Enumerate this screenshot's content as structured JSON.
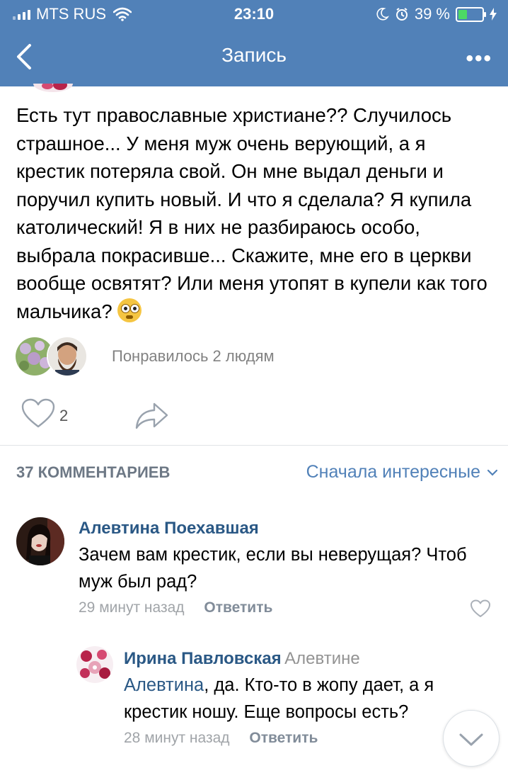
{
  "status_bar": {
    "carrier": "MTS RUS",
    "time": "23:10",
    "battery_percent": "39 %",
    "battery_level": 0.39
  },
  "nav": {
    "title": "Запись",
    "back_icon": "chevron-left-icon",
    "more_label": "•••"
  },
  "post": {
    "text": "Есть тут православные христиане?? Случилось страшное... У меня муж очень верующий, а я крестик потеряла свой. Он мне выдал деньги и поручил купить новый. И что я сделала? Я купила католический! Я в них не разбираюсь особо, выбрала покрасивше... Скажите, мне его в церкви вообще освятят? Или меня утопят в купели как того мальчика?",
    "emoji": "flushed-face-emoji",
    "likers_text": "Понравилось 2 людям",
    "like_count": "2"
  },
  "comments_header": {
    "count_label": "37 КОММЕНТАРИЕВ",
    "sort_label": "Сначала интересные"
  },
  "comments": [
    {
      "author": "Алевтина Поехавшая",
      "reply_to": "",
      "text_link": "",
      "text": "Зачем вам крестик, если вы неверущая? Чтоб муж был рад?",
      "time": "29 минут назад",
      "reply_label": "Ответить"
    },
    {
      "author": "Ирина Павловская",
      "reply_to": "Алевтине",
      "text_link": "Алевтина",
      "text": ", да. Кто-то в жопу дает, а я крестик ношу. Еще вопросы есть?",
      "time": "28 минут назад",
      "reply_label": "Ответить"
    }
  ],
  "colors": {
    "header_bg": "#5181b8",
    "link": "#2a5885",
    "accent": "#5181b8",
    "muted": "#828282"
  }
}
